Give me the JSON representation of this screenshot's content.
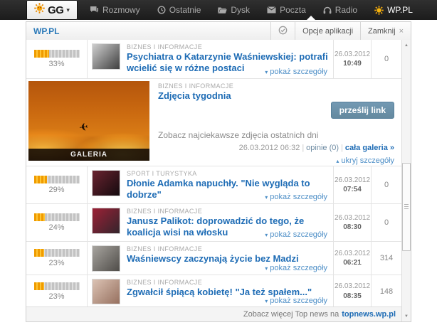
{
  "topbar": {
    "logo_text": "GG",
    "tabs": [
      {
        "label": "Rozmowy"
      },
      {
        "label": "Ostatnie"
      },
      {
        "label": "Dysk"
      },
      {
        "label": "Poczta"
      },
      {
        "label": "Radio"
      },
      {
        "label": "WP.PL"
      }
    ]
  },
  "panel": {
    "title": "WP.PL",
    "options_label": "Opcje aplikacji",
    "close_label": "Zamknij",
    "close_x": "×"
  },
  "labels": {
    "show_details": "pokaż szczegóły",
    "hide_details": "ukryj szczegóły"
  },
  "icons": {
    "dropdown_caret": "▾",
    "details_down": "▾",
    "details_up": "▴",
    "plane": "✈",
    "scroll_up": "▲",
    "scroll_down": "▼"
  },
  "news": [
    {
      "percent_label": "33%",
      "percent_value": 33,
      "category": "BIZNES I INFORMACJE",
      "title": "Psychiatra o Katarzynie Waśniewskiej: potrafi wcielić się w różne postaci",
      "date": "26.03.2012",
      "time": "10:49",
      "count": "0",
      "thumb_colors": [
        "#cfcfcf",
        "#3f3f3f"
      ]
    },
    {
      "percent_label": "29%",
      "percent_value": 29,
      "category": "SPORT I TURYSTYKA",
      "title": "Dłonie Adamka napuchły. \"Nie wygląda to dobrze\"",
      "date": "26.03.2012",
      "time": "07:54",
      "count": "0",
      "thumb_colors": [
        "#6a2430",
        "#140a0e"
      ]
    },
    {
      "percent_label": "24%",
      "percent_value": 24,
      "category": "BIZNES I INFORMACJE",
      "title": "Janusz Palikot: doprowadzić do tego, że koalicja wisi na włosku",
      "date": "26.03.2012",
      "time": "08:30",
      "count": "0",
      "thumb_colors": [
        "#9c2136",
        "#33242c"
      ]
    },
    {
      "percent_label": "23%",
      "percent_value": 23,
      "category": "BIZNES I INFORMACJE",
      "title": "Waśniewscy zaczynają życie bez Madzi",
      "date": "26.03.2012",
      "time": "06:21",
      "count": "314",
      "thumb_colors": [
        "#a8a5a0",
        "#4f4c48"
      ]
    },
    {
      "percent_label": "23%",
      "percent_value": 23,
      "category": "BIZNES I INFORMACJE",
      "title": "Zgwałcił śpiącą kobietę! \"Ja też spałem...\"",
      "date": "26.03.2012",
      "time": "08:35",
      "count": "148",
      "thumb_colors": [
        "#dcc3b4",
        "#96705f"
      ]
    }
  ],
  "gallery": {
    "category": "BIZNES I INFORMACJE",
    "title": "Zdjęcia tygodnia",
    "button_label": "prześlij link",
    "description": "Zobacz najciekawsze zdjęcia ostatnich dni",
    "meta_datetime": "26.03.2012 06:32",
    "meta_sep": "|",
    "meta_opinions": "opinie (0)",
    "meta_link": "cała galeria »",
    "image_label": "GALERIA"
  },
  "footer": {
    "text_prefix": "Zobacz więcej Top news na",
    "link": "topnews.wp.pl"
  },
  "colors": {
    "accent_blue": "#1e6cb5",
    "link_blue": "#4e8fc7",
    "progress_orange": "#f5a700",
    "topbar_bg": "#242424",
    "button_steel": "#6b93ae"
  }
}
